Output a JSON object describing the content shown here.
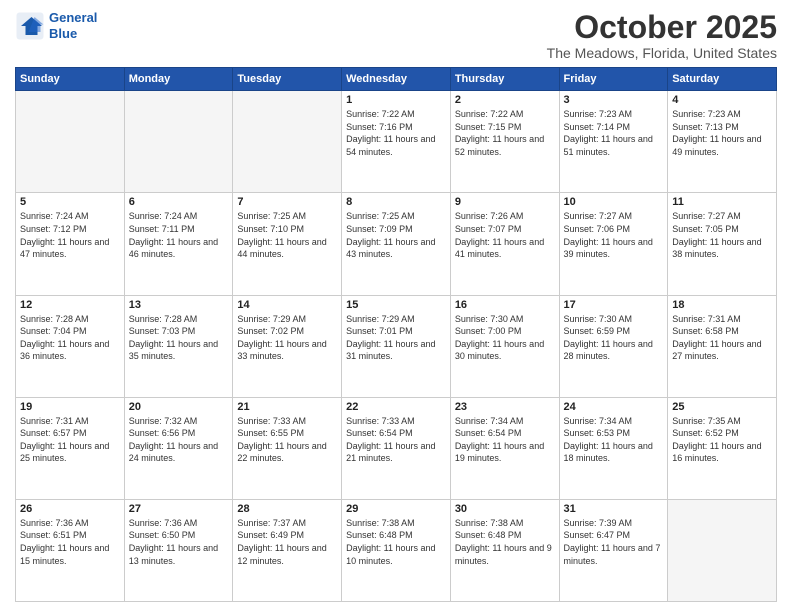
{
  "header": {
    "logo_line1": "General",
    "logo_line2": "Blue",
    "month": "October 2025",
    "location": "The Meadows, Florida, United States"
  },
  "weekdays": [
    "Sunday",
    "Monday",
    "Tuesday",
    "Wednesday",
    "Thursday",
    "Friday",
    "Saturday"
  ],
  "weeks": [
    [
      {
        "day": "",
        "empty": true
      },
      {
        "day": "",
        "empty": true
      },
      {
        "day": "",
        "empty": true
      },
      {
        "day": "1",
        "sunrise": "7:22 AM",
        "sunset": "7:16 PM",
        "daylight": "11 hours and 54 minutes."
      },
      {
        "day": "2",
        "sunrise": "7:22 AM",
        "sunset": "7:15 PM",
        "daylight": "11 hours and 52 minutes."
      },
      {
        "day": "3",
        "sunrise": "7:23 AM",
        "sunset": "7:14 PM",
        "daylight": "11 hours and 51 minutes."
      },
      {
        "day": "4",
        "sunrise": "7:23 AM",
        "sunset": "7:13 PM",
        "daylight": "11 hours and 49 minutes."
      }
    ],
    [
      {
        "day": "5",
        "sunrise": "7:24 AM",
        "sunset": "7:12 PM",
        "daylight": "11 hours and 47 minutes."
      },
      {
        "day": "6",
        "sunrise": "7:24 AM",
        "sunset": "7:11 PM",
        "daylight": "11 hours and 46 minutes."
      },
      {
        "day": "7",
        "sunrise": "7:25 AM",
        "sunset": "7:10 PM",
        "daylight": "11 hours and 44 minutes."
      },
      {
        "day": "8",
        "sunrise": "7:25 AM",
        "sunset": "7:09 PM",
        "daylight": "11 hours and 43 minutes."
      },
      {
        "day": "9",
        "sunrise": "7:26 AM",
        "sunset": "7:07 PM",
        "daylight": "11 hours and 41 minutes."
      },
      {
        "day": "10",
        "sunrise": "7:27 AM",
        "sunset": "7:06 PM",
        "daylight": "11 hours and 39 minutes."
      },
      {
        "day": "11",
        "sunrise": "7:27 AM",
        "sunset": "7:05 PM",
        "daylight": "11 hours and 38 minutes."
      }
    ],
    [
      {
        "day": "12",
        "sunrise": "7:28 AM",
        "sunset": "7:04 PM",
        "daylight": "11 hours and 36 minutes."
      },
      {
        "day": "13",
        "sunrise": "7:28 AM",
        "sunset": "7:03 PM",
        "daylight": "11 hours and 35 minutes."
      },
      {
        "day": "14",
        "sunrise": "7:29 AM",
        "sunset": "7:02 PM",
        "daylight": "11 hours and 33 minutes."
      },
      {
        "day": "15",
        "sunrise": "7:29 AM",
        "sunset": "7:01 PM",
        "daylight": "11 hours and 31 minutes."
      },
      {
        "day": "16",
        "sunrise": "7:30 AM",
        "sunset": "7:00 PM",
        "daylight": "11 hours and 30 minutes."
      },
      {
        "day": "17",
        "sunrise": "7:30 AM",
        "sunset": "6:59 PM",
        "daylight": "11 hours and 28 minutes."
      },
      {
        "day": "18",
        "sunrise": "7:31 AM",
        "sunset": "6:58 PM",
        "daylight": "11 hours and 27 minutes."
      }
    ],
    [
      {
        "day": "19",
        "sunrise": "7:31 AM",
        "sunset": "6:57 PM",
        "daylight": "11 hours and 25 minutes."
      },
      {
        "day": "20",
        "sunrise": "7:32 AM",
        "sunset": "6:56 PM",
        "daylight": "11 hours and 24 minutes."
      },
      {
        "day": "21",
        "sunrise": "7:33 AM",
        "sunset": "6:55 PM",
        "daylight": "11 hours and 22 minutes."
      },
      {
        "day": "22",
        "sunrise": "7:33 AM",
        "sunset": "6:54 PM",
        "daylight": "11 hours and 21 minutes."
      },
      {
        "day": "23",
        "sunrise": "7:34 AM",
        "sunset": "6:54 PM",
        "daylight": "11 hours and 19 minutes."
      },
      {
        "day": "24",
        "sunrise": "7:34 AM",
        "sunset": "6:53 PM",
        "daylight": "11 hours and 18 minutes."
      },
      {
        "day": "25",
        "sunrise": "7:35 AM",
        "sunset": "6:52 PM",
        "daylight": "11 hours and 16 minutes."
      }
    ],
    [
      {
        "day": "26",
        "sunrise": "7:36 AM",
        "sunset": "6:51 PM",
        "daylight": "11 hours and 15 minutes."
      },
      {
        "day": "27",
        "sunrise": "7:36 AM",
        "sunset": "6:50 PM",
        "daylight": "11 hours and 13 minutes."
      },
      {
        "day": "28",
        "sunrise": "7:37 AM",
        "sunset": "6:49 PM",
        "daylight": "11 hours and 12 minutes."
      },
      {
        "day": "29",
        "sunrise": "7:38 AM",
        "sunset": "6:48 PM",
        "daylight": "11 hours and 10 minutes."
      },
      {
        "day": "30",
        "sunrise": "7:38 AM",
        "sunset": "6:48 PM",
        "daylight": "11 hours and 9 minutes."
      },
      {
        "day": "31",
        "sunrise": "7:39 AM",
        "sunset": "6:47 PM",
        "daylight": "11 hours and 7 minutes."
      },
      {
        "day": "",
        "empty": true
      }
    ]
  ]
}
